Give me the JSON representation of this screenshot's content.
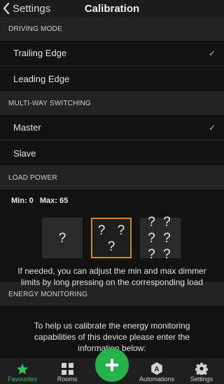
{
  "header": {
    "back_label": "Settings",
    "title": "Calibration"
  },
  "driving_mode": {
    "label": "DRIVING MODE",
    "options": [
      {
        "label": "Trailing Edge",
        "selected": true
      },
      {
        "label": "Leading Edge",
        "selected": false
      }
    ]
  },
  "multi_way": {
    "label": "MULTI-WAY SWITCHING",
    "options": [
      {
        "label": "Master",
        "selected": true
      },
      {
        "label": "Slave",
        "selected": false
      }
    ]
  },
  "load_power": {
    "label": "LOAD POWER",
    "min_label": "Min: 0",
    "max_label": "Max: 65",
    "loads": [
      {
        "text": "?",
        "selected": false
      },
      {
        "text": "? ? ?",
        "selected": true
      },
      {
        "text": "? ? ? ? ? ?",
        "selected": false
      }
    ],
    "hint": "If needed, you can adjust the min and max dimmer limits by long pressing on the corresponding load"
  },
  "energy": {
    "label": "ENERGY MONITORING",
    "text": "To help us calibrate the energy monitoring capabilities of this device please enter the information below:"
  },
  "tabbar": {
    "tabs": [
      {
        "label": "Favourites",
        "icon": "star-icon",
        "active": true
      },
      {
        "label": "Rooms",
        "icon": "grid-icon",
        "active": false
      },
      {
        "label": "Automations",
        "icon": "automations-icon",
        "active": false
      },
      {
        "label": "Settings",
        "icon": "gear-icon",
        "active": false
      }
    ],
    "fab_icon": "plus-icon"
  },
  "colors": {
    "accent_green": "#24b24a",
    "selected_border": "#c98a2b"
  }
}
